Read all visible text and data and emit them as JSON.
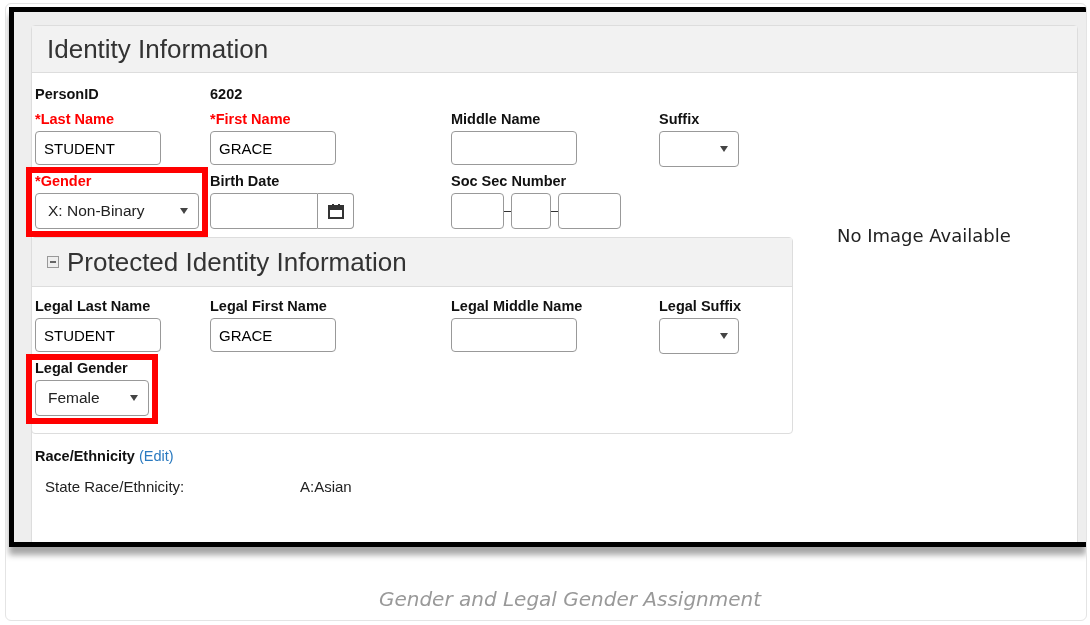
{
  "panel": {
    "title": "Identity Information"
  },
  "person_id": {
    "label": "PersonID",
    "value": "6202"
  },
  "rows": [
    [
      {
        "kind": "text",
        "label": "*Last Name",
        "required": true,
        "value": "STUDENT",
        "highlighted": false
      },
      {
        "kind": "text",
        "label": "*First Name",
        "required": true,
        "value": "GRACE",
        "highlighted": false
      },
      {
        "kind": "text",
        "label": "Middle Name",
        "required": false,
        "highlighted": false
      },
      {
        "kind": "select",
        "label": "Suffix",
        "required": false,
        "highlighted": false
      }
    ],
    [
      {
        "kind": "select",
        "label": "*Gender",
        "required": true,
        "value": "X: Non-Binary",
        "highlighted": true
      },
      {
        "kind": "date",
        "label": "Birth Date",
        "required": false,
        "highlighted": false
      },
      {
        "kind": "ssn",
        "label": "Soc Sec Number",
        "required": false,
        "highlighted": false
      }
    ]
  ],
  "photo": {
    "text": "No Image Available"
  },
  "protected": {
    "title": "Protected Identity Information",
    "expanded": true,
    "rows": [
      [
        {
          "kind": "text",
          "label": "Legal Last Name",
          "required": false,
          "value": "STUDENT",
          "highlighted": false
        },
        {
          "kind": "text",
          "label": "Legal First Name",
          "required": false,
          "value": "GRACE",
          "highlighted": false
        },
        {
          "kind": "text",
          "label": "Legal Middle Name",
          "required": false,
          "highlighted": false
        },
        {
          "kind": "select",
          "label": "Legal Suffix",
          "required": false,
          "highlighted": false
        }
      ],
      [
        {
          "kind": "select",
          "label": "Legal Gender",
          "required": false,
          "value": "Female",
          "highlighted": true
        }
      ]
    ]
  },
  "race": {
    "label": "Race/Ethnicity",
    "link": "(Edit)",
    "rows": [
      {
        "label": "State Race/Ethnicity:",
        "value": "A:Asian"
      }
    ]
  },
  "caption": "Gender and Legal Gender Assignment"
}
